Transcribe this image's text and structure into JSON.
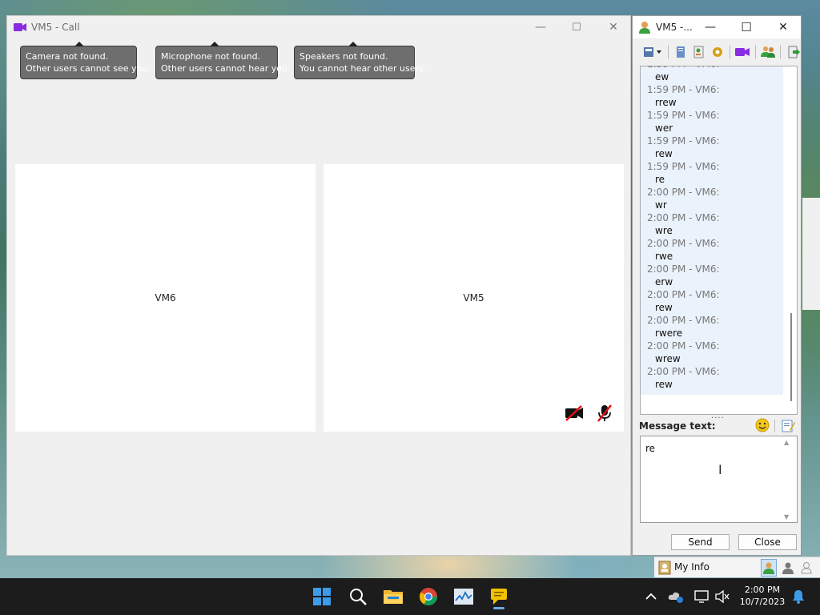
{
  "call_window": {
    "title": "VM5 - Call",
    "controls": {
      "minimize": "—",
      "maximize": "☐",
      "close": "✕"
    },
    "notifications": [
      {
        "line1": "Camera not found.",
        "line2": "Other users cannot see you."
      },
      {
        "line1": "Microphone not found.",
        "line2": "Other users cannot hear you."
      },
      {
        "line1": "Speakers not found.",
        "line2": "You cannot hear other users."
      }
    ],
    "panes": [
      {
        "label": "VM6"
      },
      {
        "label": "VM5"
      }
    ]
  },
  "chat_window": {
    "title": "VM5 -...",
    "controls": {
      "minimize": "—",
      "maximize": "☐",
      "close": "✕"
    },
    "messages": [
      {
        "header": "1:59 PM - VM6:",
        "text": "ew"
      },
      {
        "header": "1:59 PM - VM6:",
        "text": "rrew"
      },
      {
        "header": "1:59 PM - VM6:",
        "text": "wer"
      },
      {
        "header": "1:59 PM - VM6:",
        "text": "rew"
      },
      {
        "header": "1:59 PM - VM6:",
        "text": "re"
      },
      {
        "header": "2:00 PM - VM6:",
        "text": "wr"
      },
      {
        "header": "2:00 PM - VM6:",
        "text": "wre"
      },
      {
        "header": "2:00 PM - VM6:",
        "text": "rwe"
      },
      {
        "header": "2:00 PM - VM6:",
        "text": "erw"
      },
      {
        "header": "2:00 PM - VM6:",
        "text": "rew"
      },
      {
        "header": "2:00 PM - VM6:",
        "text": "rwere"
      },
      {
        "header": "2:00 PM - VM6:",
        "text": "wrew"
      },
      {
        "header": "2:00 PM - VM6:",
        "text": "rew"
      }
    ],
    "splitter": "····",
    "message_label": "Message text:",
    "input_value": "re",
    "send_label": "Send",
    "close_label": "Close"
  },
  "my_info": {
    "label": "My Info"
  },
  "taskbar": {
    "apps": [
      "start-icon",
      "search-icon",
      "file-explorer-icon",
      "chrome-icon",
      "task-manager-icon",
      "messenger-icon"
    ],
    "time": "2:00 PM",
    "date": "10/7/2023"
  },
  "colors": {
    "call_icon": "#8a2be2",
    "tooltip_bg": "#6e6e6e",
    "chat_bg": "#eaf2fb",
    "taskbar_bg": "#1c1c1c"
  }
}
